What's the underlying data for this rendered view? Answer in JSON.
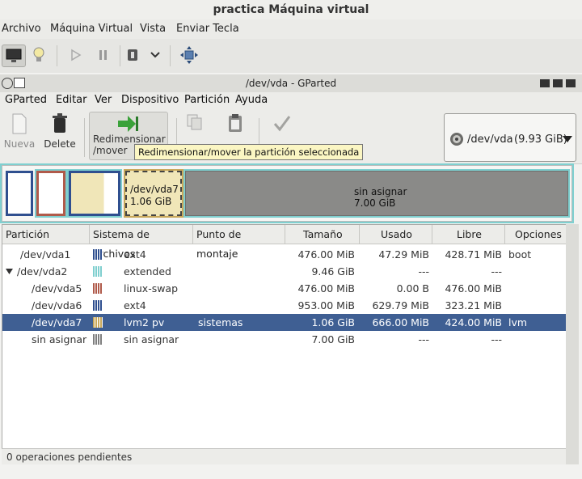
{
  "vm": {
    "title": "practica Máquina virtual",
    "menu": [
      "Archivo",
      "Máquina Virtual",
      "Vista",
      "Enviar Tecla"
    ]
  },
  "gparted": {
    "title": "/dev/vda - GParted",
    "menu": [
      "GParted",
      "Editar",
      "Ver",
      "Dispositivo",
      "Partición",
      "Ayuda"
    ],
    "toolbar": {
      "new": "Nueva",
      "delete": "Delete",
      "resize_line1": "Redimensionar",
      "resize_line2": "/mover"
    },
    "tooltip": "Redimensionar/mover la partición seleccionada",
    "device": {
      "name": "/dev/vda",
      "size": "(9.93 GiB)"
    },
    "map": {
      "vda7_name": "/dev/vda7",
      "vda7_size": "1.06 GiB",
      "unalloc_name": "sin asignar",
      "unalloc_size": "7.00 GiB"
    },
    "columns": [
      "Partición",
      "Sistema de archivos",
      "Punto de montaje",
      "Tamaño",
      "Usado",
      "Libre",
      "Opciones"
    ],
    "rows": [
      {
        "partition": "/dev/vda1",
        "fs": "ext4",
        "mount": "",
        "size": "476.00 MiB",
        "used": "47.29 MiB",
        "free": "428.71 MiB",
        "flags": "boot",
        "color": "#2f4f8f"
      },
      {
        "partition": "/dev/vda2",
        "fs": "extended",
        "mount": "",
        "size": "9.46 GiB",
        "used": "---",
        "free": "---",
        "flags": "",
        "color": "#7fcfcf"
      },
      {
        "partition": "/dev/vda5",
        "fs": "linux-swap",
        "mount": "",
        "size": "476.00 MiB",
        "used": "0.00 B",
        "free": "476.00 MiB",
        "flags": "",
        "color": "#b05a4a"
      },
      {
        "partition": "/dev/vda6",
        "fs": "ext4",
        "mount": "",
        "size": "953.00 MiB",
        "used": "629.79 MiB",
        "free": "323.21 MiB",
        "flags": "",
        "color": "#2f4f8f"
      },
      {
        "partition": "/dev/vda7",
        "fs": "lvm2 pv",
        "mount": "sistemas",
        "size": "1.06 GiB",
        "used": "666.00 MiB",
        "free": "424.00 MiB",
        "flags": "lvm",
        "color": "#c9a85a"
      },
      {
        "partition": "sin asignar",
        "fs": "sin asignar",
        "mount": "",
        "size": "7.00 GiB",
        "used": "---",
        "free": "---",
        "flags": "",
        "color": "#7f7f7f"
      }
    ],
    "status": "0 operaciones pendientes"
  }
}
